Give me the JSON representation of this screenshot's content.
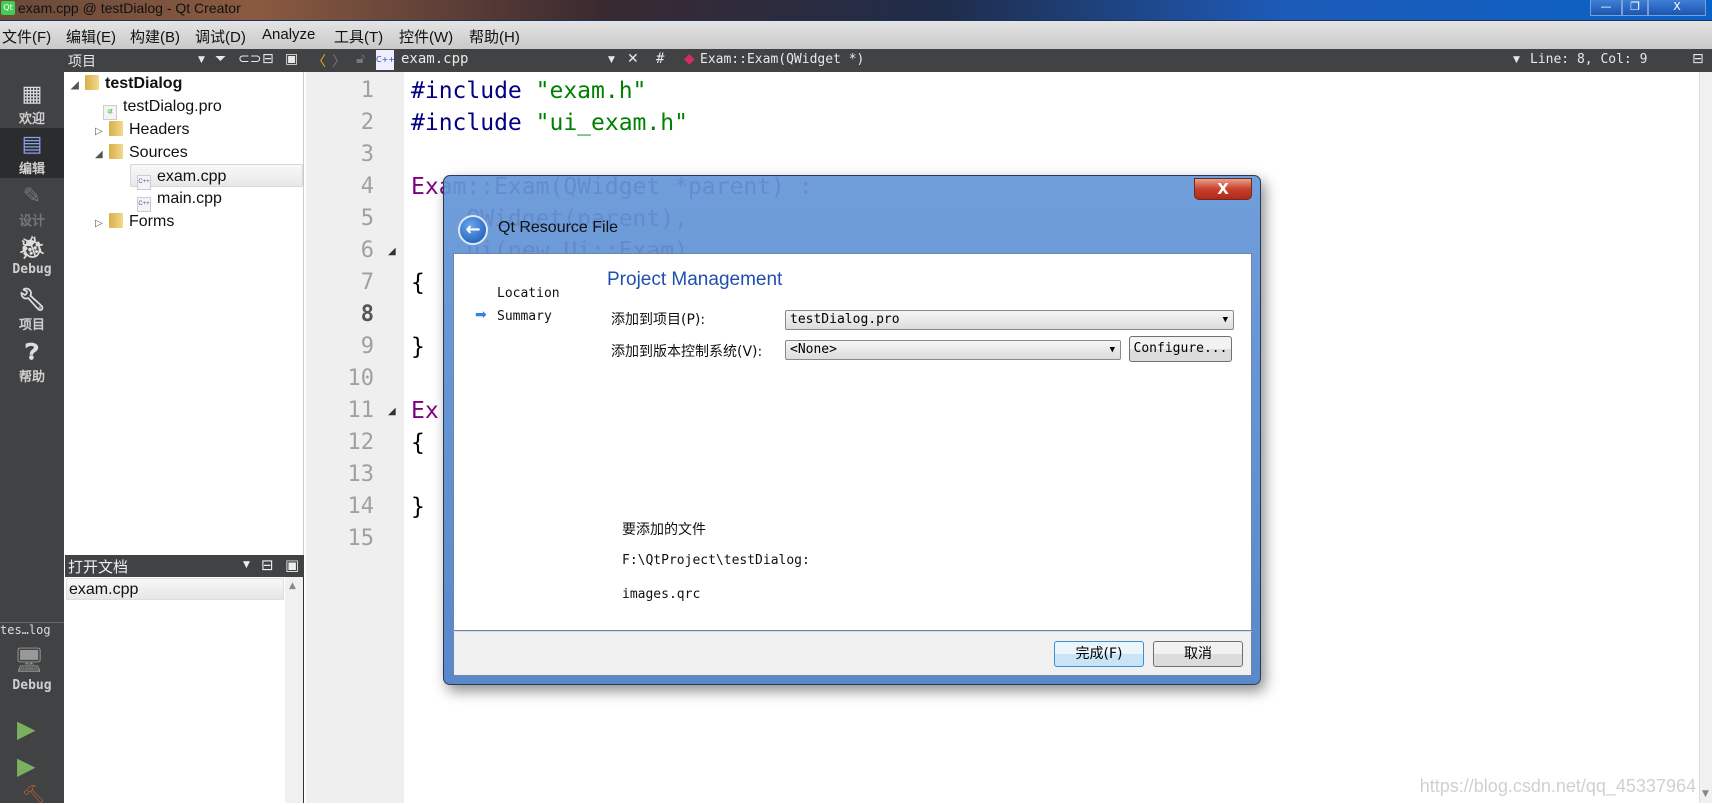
{
  "window": {
    "title": "exam.cpp @ testDialog - Qt Creator",
    "controls": [
      "minimize",
      "restore",
      "close"
    ]
  },
  "menu": [
    "文件(F)",
    "编辑(E)",
    "构建(B)",
    "调试(D)",
    "Analyze",
    "工具(T)",
    "控件(W)",
    "帮助(H)"
  ],
  "toolbar": {
    "panel_title": "项目",
    "file_name": "exam.cpp",
    "symbol": "Exam::Exam(QWidget *)",
    "hash": "#",
    "position": "Line: 8, Col: 9"
  },
  "modes": [
    {
      "label": "欢迎",
      "icon": "grid-icon"
    },
    {
      "label": "编辑",
      "icon": "edit-doc-icon",
      "active": true
    },
    {
      "label": "设计",
      "icon": "pencil-icon",
      "disabled": true
    },
    {
      "label": "Debug",
      "icon": "bug-icon"
    },
    {
      "label": "项目",
      "icon": "wrench-icon"
    },
    {
      "label": "帮助",
      "icon": "help-icon"
    }
  ],
  "target": {
    "project": "tes…log",
    "build": "Debug"
  },
  "tree": [
    {
      "label": "testDialog",
      "type": "project",
      "expanded": true
    },
    {
      "label": "testDialog.pro",
      "type": "pro"
    },
    {
      "label": "Headers",
      "type": "folder",
      "expanded": false
    },
    {
      "label": "Sources",
      "type": "folder",
      "expanded": true
    },
    {
      "label": "exam.cpp",
      "type": "cpp",
      "selected": true
    },
    {
      "label": "main.cpp",
      "type": "cpp"
    },
    {
      "label": "Forms",
      "type": "folder",
      "expanded": false
    }
  ],
  "open_docs": {
    "title": "打开文档",
    "items": [
      "exam.cpp"
    ]
  },
  "editor": {
    "line_numbers": [
      "1",
      "2",
      "3",
      "4",
      "5",
      "6",
      "7",
      "8",
      "9",
      "10",
      "11",
      "12",
      "13",
      "14",
      "15"
    ],
    "current_line": 8,
    "lines": [
      [
        {
          "t": "#include ",
          "c": "#000080"
        },
        {
          "t": "\"exam.h\"",
          "c": "#008000"
        }
      ],
      [
        {
          "t": "#include ",
          "c": "#000080"
        },
        {
          "t": "\"ui_exam.h\"",
          "c": "#008000"
        }
      ],
      [],
      [
        {
          "t": "Exam::Exam(QWidget *parent) :",
          "c": "#800080"
        }
      ],
      [
        {
          "t": "    QWidget(parent),",
          "c": "#800080"
        }
      ],
      [
        {
          "t": "    ui(new Ui::Exam)",
          "c": "#800080"
        }
      ],
      [
        {
          "t": "{",
          "c": "#000000"
        }
      ],
      [],
      [
        {
          "t": "}",
          "c": "#000000"
        }
      ],
      [],
      [
        {
          "t": "Ex",
          "c": "#800080"
        }
      ],
      [
        {
          "t": "{",
          "c": "#000000"
        }
      ],
      [],
      [
        {
          "t": "}",
          "c": "#000000"
        }
      ],
      []
    ]
  },
  "dialog": {
    "title": "Qt Resource File",
    "close": "X",
    "steps": [
      {
        "label": "Location",
        "current": false
      },
      {
        "label": "Summary",
        "current": true
      }
    ],
    "heading": "Project Management",
    "add_to_project_label": "添加到项目(P):",
    "add_to_project_value": "testDialog.pro",
    "vcs_label": "添加到版本控制系统(V):",
    "vcs_value": "<None>",
    "configure": "Configure...",
    "files_label": "要添加的文件",
    "files_dir": "F:\\QtProject\\testDialog:",
    "files": "images.qrc",
    "finish": "完成(F)",
    "cancel": "取消",
    "accent": "#1f4fb0"
  },
  "watermark": "https://blog.csdn.net/qq_45337964"
}
